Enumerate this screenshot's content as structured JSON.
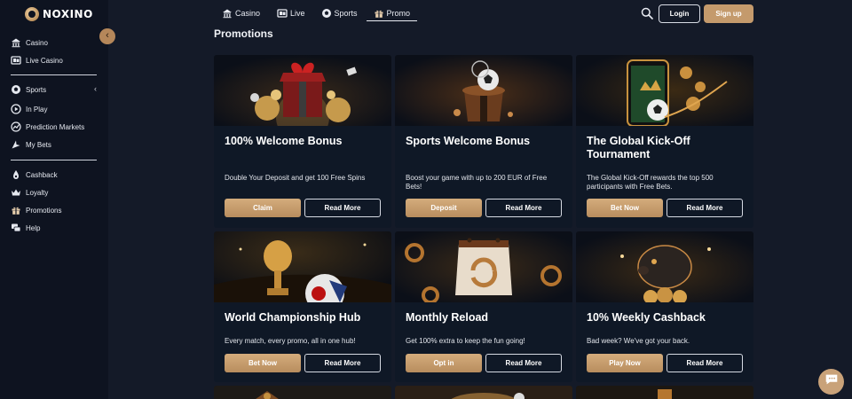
{
  "brand": {
    "name": "NOXINO"
  },
  "sidebar": {
    "groups": [
      [
        {
          "label": "Casino",
          "icon": "casino-icon"
        },
        {
          "label": "Live Casino",
          "icon": "live-casino-icon"
        }
      ],
      [
        {
          "label": "Sports",
          "icon": "sports-ball-icon"
        },
        {
          "label": "In Play",
          "icon": "in-play-icon"
        },
        {
          "label": "Prediction Markets",
          "icon": "prediction-markets-icon"
        },
        {
          "label": "My Bets",
          "icon": "my-bets-icon"
        }
      ],
      [
        {
          "label": "Cashback",
          "icon": "cashback-icon"
        },
        {
          "label": "Loyalty",
          "icon": "loyalty-crown-icon"
        },
        {
          "label": "Promotions",
          "icon": "promotions-gift-icon"
        },
        {
          "label": "Help",
          "icon": "help-icon"
        }
      ]
    ],
    "collapse_glyph": "‹",
    "sports_chevron": "‹"
  },
  "header": {
    "tabs": [
      {
        "label": "Casino",
        "icon": "casino-icon"
      },
      {
        "label": "Live",
        "icon": "live-icon"
      },
      {
        "label": "Sports",
        "icon": "sports-ball-icon"
      },
      {
        "label": "Promo",
        "icon": "gift-icon",
        "active": true
      }
    ],
    "login_label": "Login",
    "signup_label": "Sign up"
  },
  "main": {
    "title": "Promotions",
    "cards": [
      {
        "title": "100% Welcome Bonus",
        "desc": "Double Your Deposit and get 100 Free Spins",
        "primary": "Claim",
        "secondary": "Read More"
      },
      {
        "title": "Sports Welcome Bonus",
        "desc": "Boost your game with up to 200 EUR of Free Bets!",
        "primary": "Deposit",
        "secondary": "Read More"
      },
      {
        "title": "The Global Kick-Off Tournament",
        "desc": "The Global Kick-Off rewards the top 500 participants with Free Bets.",
        "primary": "Bet Now",
        "secondary": "Read More"
      },
      {
        "title": "World Championship Hub",
        "desc": "Every match, every promo, all in one hub!",
        "primary": "Bet Now",
        "secondary": "Read More"
      },
      {
        "title": "Monthly Reload",
        "desc": "Get 100% extra to keep the fun going!",
        "primary": "Opt in",
        "secondary": "Read More"
      },
      {
        "title": "10% Weekly Cashback",
        "desc": "Bad week? We've got your back.",
        "primary": "Play Now",
        "secondary": "Read More"
      }
    ]
  },
  "colors": {
    "accent": "#c49a6c",
    "background": "#141a28",
    "sidebar": "#0e1320",
    "card": "#0f1826"
  }
}
